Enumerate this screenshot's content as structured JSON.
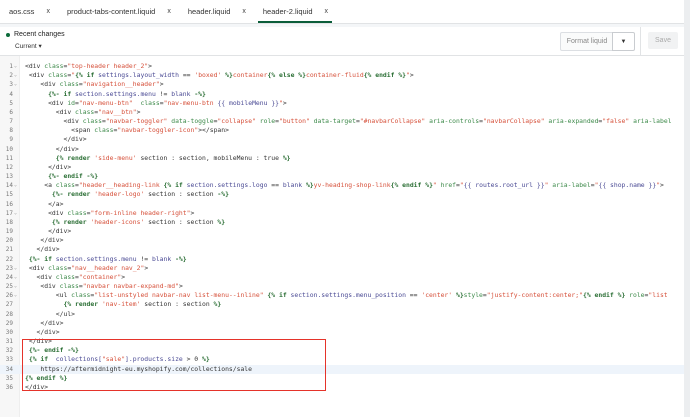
{
  "tabs": [
    {
      "label": "aos.css"
    },
    {
      "label": "product-tabs-content.liquid"
    },
    {
      "label": "header.liquid"
    },
    {
      "label": "header-2.liquid",
      "active": true
    }
  ],
  "toolbar": {
    "recent_changes": "Recent changes",
    "version": "Current",
    "format_label": "Format liquid",
    "save_label": "Save"
  },
  "colors": {
    "accent": "#0b5d3a",
    "highlight_box": "#e5332a"
  },
  "code": {
    "highlighted_line": 34,
    "lines": [
      {
        "n": "1",
        "f": true,
        "s": [
          [
            "p",
            "<div "
          ],
          [
            "a",
            "class"
          ],
          [
            "p",
            "="
          ],
          [
            "s",
            "\"top-header header_2\""
          ],
          [
            "p",
            ">"
          ]
        ]
      },
      {
        "n": "2",
        "f": true,
        "s": [
          [
            "p",
            " <div "
          ],
          [
            "a",
            "class"
          ],
          [
            "p",
            "="
          ],
          [
            "s",
            "\""
          ],
          [
            "k",
            "{% if "
          ],
          [
            "v",
            "settings.layout_width"
          ],
          [
            "p",
            " == "
          ],
          [
            "s",
            "'boxed'"
          ],
          [
            "k",
            " %}"
          ],
          [
            "s",
            "container"
          ],
          [
            "k",
            "{% else %}"
          ],
          [
            "s",
            "container-fluid"
          ],
          [
            "k",
            "{% endif %}"
          ],
          [
            "s",
            "\""
          ],
          [
            "p",
            ">"
          ]
        ]
      },
      {
        "n": "3",
        "f": true,
        "s": [
          [
            "p",
            "    <div "
          ],
          [
            "a",
            "class"
          ],
          [
            "p",
            "="
          ],
          [
            "s",
            "\"navigation__header\""
          ],
          [
            "p",
            ">"
          ]
        ]
      },
      {
        "n": "4",
        "s": [
          [
            "k",
            "      {%- if "
          ],
          [
            "v",
            "section.settings.menu"
          ],
          [
            "p",
            " != "
          ],
          [
            "v",
            "blank"
          ],
          [
            "k",
            " -%}"
          ]
        ]
      },
      {
        "n": "5",
        "s": [
          [
            "p",
            "      <div "
          ],
          [
            "a",
            "id"
          ],
          [
            "p",
            "="
          ],
          [
            "s",
            "\"nav-menu-btn\""
          ],
          [
            "p",
            "  "
          ],
          [
            "a",
            "class"
          ],
          [
            "p",
            "="
          ],
          [
            "s",
            "\"nav-menu-btn "
          ],
          [
            "v",
            "{{ mobileMenu }}"
          ],
          [
            "s",
            "\""
          ],
          [
            "p",
            ">"
          ]
        ]
      },
      {
        "n": "6",
        "s": [
          [
            "p",
            "        <div "
          ],
          [
            "a",
            "class"
          ],
          [
            "p",
            "="
          ],
          [
            "s",
            "\"nav__btn\""
          ],
          [
            "p",
            ">"
          ]
        ]
      },
      {
        "n": "7",
        "s": [
          [
            "p",
            "          <div "
          ],
          [
            "a",
            "class"
          ],
          [
            "p",
            "="
          ],
          [
            "s",
            "\"navbar-toggler\""
          ],
          [
            "a",
            " data-toggle"
          ],
          [
            "p",
            "="
          ],
          [
            "s",
            "\"collapse\""
          ],
          [
            "a",
            " role"
          ],
          [
            "p",
            "="
          ],
          [
            "s",
            "\"button\""
          ],
          [
            "a",
            " data-target"
          ],
          [
            "p",
            "="
          ],
          [
            "s",
            "\"#navbarCollapse\""
          ],
          [
            "a",
            " aria-controls"
          ],
          [
            "p",
            "="
          ],
          [
            "s",
            "\"navbarCollapse\""
          ],
          [
            "a",
            " aria-expanded"
          ],
          [
            "p",
            "="
          ],
          [
            "s",
            "\"false\""
          ],
          [
            "a",
            " aria-label"
          ]
        ]
      },
      {
        "n": "8",
        "s": [
          [
            "p",
            "            <span "
          ],
          [
            "a",
            "class"
          ],
          [
            "p",
            "="
          ],
          [
            "s",
            "\"navbar-toggler-icon\""
          ],
          [
            "p",
            "></span>"
          ]
        ]
      },
      {
        "n": "9",
        "s": [
          [
            "p",
            "          </div>"
          ]
        ]
      },
      {
        "n": "10",
        "s": [
          [
            "p",
            "        </div>"
          ]
        ]
      },
      {
        "n": "11",
        "s": [
          [
            "k",
            "        {% render "
          ],
          [
            "s",
            "'side-menu'"
          ],
          [
            "p",
            " section : section, mobileMenu : true "
          ],
          [
            "k",
            "%}"
          ]
        ]
      },
      {
        "n": "12",
        "s": [
          [
            "p",
            "      </div>"
          ]
        ]
      },
      {
        "n": "13",
        "s": [
          [
            "k",
            "      {%- endif -%}"
          ]
        ]
      },
      {
        "n": "14",
        "f": true,
        "s": [
          [
            "p",
            "     <a "
          ],
          [
            "a",
            "class"
          ],
          [
            "p",
            "="
          ],
          [
            "s",
            "\"header__heading-link "
          ],
          [
            "k",
            "{% if "
          ],
          [
            "v",
            "section.settings.logo"
          ],
          [
            "p",
            " == "
          ],
          [
            "v",
            "blank"
          ],
          [
            "k",
            " %}"
          ],
          [
            "s",
            "yv-heading-shop-link"
          ],
          [
            "k",
            "{% endif %}"
          ],
          [
            "s",
            "\""
          ],
          [
            "a",
            " href"
          ],
          [
            "p",
            "="
          ],
          [
            "s",
            "\""
          ],
          [
            "v",
            "{{ routes.root_url }}"
          ],
          [
            "s",
            "\""
          ],
          [
            "a",
            " aria-label"
          ],
          [
            "p",
            "="
          ],
          [
            "s",
            "\""
          ],
          [
            "v",
            "{{ shop.name }}"
          ],
          [
            "s",
            "\""
          ],
          [
            "p",
            ">"
          ]
        ]
      },
      {
        "n": "15",
        "s": [
          [
            "k",
            "       {%- render "
          ],
          [
            "s",
            "'header-logo'"
          ],
          [
            "p",
            " section : section "
          ],
          [
            "k",
            "-%}"
          ]
        ]
      },
      {
        "n": "16",
        "s": [
          [
            "p",
            "      </a>"
          ]
        ]
      },
      {
        "n": "17",
        "f": true,
        "s": [
          [
            "p",
            "      <div "
          ],
          [
            "a",
            "class"
          ],
          [
            "p",
            "="
          ],
          [
            "s",
            "\"form-inline header-right\""
          ],
          [
            "p",
            ">"
          ]
        ]
      },
      {
        "n": "18",
        "s": [
          [
            "k",
            "       {% render "
          ],
          [
            "s",
            "'header-icons'"
          ],
          [
            "p",
            " section : section "
          ],
          [
            "k",
            "%}"
          ]
        ]
      },
      {
        "n": "19",
        "s": [
          [
            "p",
            "      </div>"
          ]
        ]
      },
      {
        "n": "20",
        "s": [
          [
            "p",
            "    </div>"
          ]
        ]
      },
      {
        "n": "21",
        "s": [
          [
            "p",
            "   </div>"
          ]
        ]
      },
      {
        "n": "22",
        "s": [
          [
            "k",
            " {%- if "
          ],
          [
            "v",
            "section.settings.menu"
          ],
          [
            "p",
            " != "
          ],
          [
            "v",
            "blank"
          ],
          [
            "k",
            " -%}"
          ]
        ]
      },
      {
        "n": "23",
        "f": true,
        "s": [
          [
            "p",
            " <div "
          ],
          [
            "a",
            "class"
          ],
          [
            "p",
            "="
          ],
          [
            "s",
            "\"nav__header nav_2\""
          ],
          [
            "p",
            ">"
          ]
        ]
      },
      {
        "n": "24",
        "f": true,
        "s": [
          [
            "p",
            "   <div "
          ],
          [
            "a",
            "class"
          ],
          [
            "p",
            "="
          ],
          [
            "s",
            "\"container\""
          ],
          [
            "p",
            ">"
          ]
        ]
      },
      {
        "n": "25",
        "f": true,
        "s": [
          [
            "p",
            "    <div "
          ],
          [
            "a",
            "class"
          ],
          [
            "p",
            "="
          ],
          [
            "s",
            "\"navbar navbar-expand-md\""
          ],
          [
            "p",
            ">"
          ]
        ]
      },
      {
        "n": "26",
        "f": true,
        "s": [
          [
            "p",
            "        <ul "
          ],
          [
            "a",
            "class"
          ],
          [
            "p",
            "="
          ],
          [
            "s",
            "\"list-unstyled navbar-nav list-menu--inline\""
          ],
          [
            "k",
            " {% if "
          ],
          [
            "v",
            "section.settings.menu_position"
          ],
          [
            "p",
            " == "
          ],
          [
            "s",
            "'center'"
          ],
          [
            "k",
            " %}"
          ],
          [
            "a",
            "style"
          ],
          [
            "p",
            "="
          ],
          [
            "s",
            "\"justify-content:center;\""
          ],
          [
            "k",
            "{% endif %}"
          ],
          [
            "a",
            " role"
          ],
          [
            "p",
            "="
          ],
          [
            "s",
            "\"list"
          ]
        ]
      },
      {
        "n": "27",
        "s": [
          [
            "k",
            "          {% render "
          ],
          [
            "s",
            "'nav-item'"
          ],
          [
            "p",
            " section : section "
          ],
          [
            "k",
            "%}"
          ]
        ]
      },
      {
        "n": "28",
        "s": [
          [
            "p",
            "        </ul>"
          ]
        ]
      },
      {
        "n": "29",
        "s": [
          [
            "p",
            "    </div>"
          ]
        ]
      },
      {
        "n": "30",
        "s": [
          [
            "p",
            "   </div>"
          ]
        ]
      },
      {
        "n": "31",
        "s": [
          [
            "p",
            " </div>"
          ]
        ]
      },
      {
        "n": "32",
        "s": [
          [
            "k",
            " {%- endif -%}"
          ]
        ]
      },
      {
        "n": "33",
        "s": [
          [
            "k",
            " {% if  "
          ],
          [
            "v",
            "collections["
          ],
          [
            "s",
            "\"sale\""
          ],
          [
            "v",
            "].products.size"
          ],
          [
            "p",
            " > 0 "
          ],
          [
            "k",
            "%}"
          ]
        ]
      },
      {
        "n": "34",
        "s": [
          [
            "p",
            "    https://aftermidnight-eu.myshopify.com/collections/sale"
          ]
        ]
      },
      {
        "n": "35",
        "s": [
          [
            "k",
            "{% endif %}"
          ]
        ]
      },
      {
        "n": "36",
        "s": [
          [
            "p",
            "</div>"
          ]
        ]
      }
    ]
  }
}
